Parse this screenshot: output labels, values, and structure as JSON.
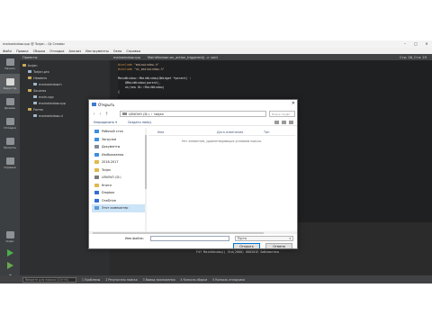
{
  "titlebar": {
    "text": "mainwindow.cpp @ Torjan - Qt Creator",
    "min": "–",
    "max": "□",
    "close": "✕"
  },
  "menubar": [
    "Файл",
    "Правка",
    "Сборка",
    "Отладка",
    "Анализ",
    "Инструменты",
    "Окно",
    "Справка"
  ],
  "modes": [
    {
      "label": "Начало"
    },
    {
      "label": "Редактор"
    },
    {
      "label": "Дизайн"
    },
    {
      "label": "Отладка"
    },
    {
      "label": "Проекты"
    },
    {
      "label": "Справка"
    }
  ],
  "mode_bottom": {
    "project_label": "torjan",
    "target_label": "Отладка"
  },
  "project_panel": {
    "header": "Проекты",
    "tree": [
      {
        "label": "torjan",
        "kind": "folder"
      },
      {
        "label": "Torjan.pro",
        "kind": "file"
      },
      {
        "label": "Headers",
        "kind": "folder"
      },
      {
        "label": "mainwindow.h",
        "kind": "file"
      },
      {
        "label": "Sources",
        "kind": "folder"
      },
      {
        "label": "main.cpp",
        "kind": "file"
      },
      {
        "label": "mainwindow.cpp",
        "kind": "file"
      },
      {
        "label": "Forms",
        "kind": "folder"
      },
      {
        "label": "mainwindow.ui",
        "kind": "file"
      }
    ]
  },
  "editor": {
    "tab": "mainwindow.cpp",
    "func_crumb": "MainWindow::on_action_triggered() -> void",
    "position": "Стр: 26, Стл: 25",
    "code": [
      {
        "kw": "#include",
        "rest": " \"mainwindow.h\"",
        "cls": "c-str"
      },
      {
        "kw": "#include",
        "rest": " \"ui_mainwindow.h\"",
        "cls": "c-str"
      },
      {
        "kw": "",
        "rest": "",
        "cls": ""
      },
      {
        "kw": "",
        "rest": "MainWindow::MainWindow(QWidget *parent) :",
        "cls": "c-fn"
      },
      {
        "kw": "",
        "rest": "    QMainWindow(parent),",
        "cls": "c-fn"
      },
      {
        "kw": "",
        "rest": "    ui(new Ui::MainWindow)",
        "cls": "c-fn"
      },
      {
        "kw": "",
        "rest": "{",
        "cls": "c-fn"
      }
    ]
  },
  "output": {
    "text": "F4f MainWindow() Std(2000) 000201E Библиотека"
  },
  "statusbar": {
    "locator_placeholder": "Введите для поиска (Ctrl+K)",
    "panels": [
      "1 Проблемы",
      "2 Результаты поиска",
      "3 Вывод приложения",
      "4 Консоль сборки",
      "5 Консоль отладчика"
    ]
  },
  "dialog": {
    "title": "Открыть",
    "close": "✕",
    "nav": {
      "back": "‹",
      "forward": "›",
      "up": "↑"
    },
    "address": [
      "LENOVO (D:)",
      "torjan"
    ],
    "search_placeholder": "Поиск: torjan",
    "toolbar": {
      "organize": "Упорядочить ▾",
      "new_folder": "Создать папку"
    },
    "nav_items": [
      {
        "label": "Рабочий стол",
        "color": "#3b8ee0"
      },
      {
        "label": "Загрузки",
        "color": "#3b8ee0"
      },
      {
        "label": "Документы",
        "color": "#7f8c9a"
      },
      {
        "label": "Изображения",
        "color": "#3b8ee0"
      },
      {
        "label": "2018-2017",
        "color": "#e0b94a"
      },
      {
        "label": "Torjan",
        "color": "#e0b94a"
      },
      {
        "label": "LENOVO (D:)",
        "color": "#7a7a7a"
      },
      {
        "label": "Книги",
        "color": "#e0b94a"
      },
      {
        "label": "Dropbox",
        "color": "#2e6fd9"
      },
      {
        "label": "OneDrive",
        "color": "#2e6fd9"
      },
      {
        "label": "Этот компьютер",
        "color": "#5b9bd5",
        "selected": true
      }
    ],
    "columns": {
      "name": "Имя",
      "date": "Дата изменения",
      "type": "Тип"
    },
    "empty_message": "Нет элементов, удовлетворяющих условиям поиска.",
    "filename_label": "Имя файла:",
    "filename_value": "",
    "filter_value": "Пусто",
    "open_button": "Открыть",
    "cancel_button": "Отмена"
  }
}
